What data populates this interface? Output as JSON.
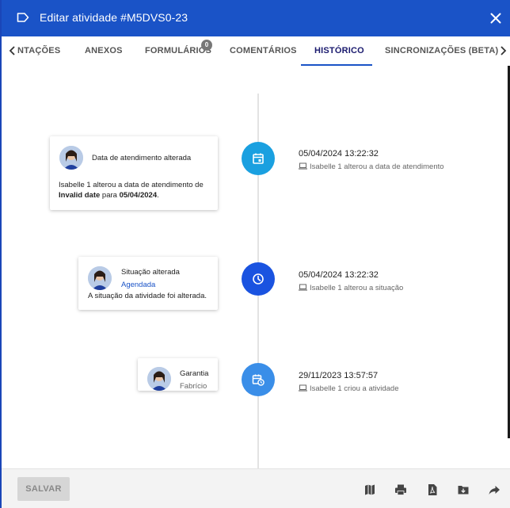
{
  "header": {
    "title": "Editar atividade  #M5DVS0-23"
  },
  "tabs": [
    {
      "label": "NTAÇÕES"
    },
    {
      "label": "ANEXOS"
    },
    {
      "label": "FORMULÁRIOS",
      "badge": "0"
    },
    {
      "label": "COMENTÁRIOS"
    },
    {
      "label": "HISTÓRICO",
      "active": true
    },
    {
      "label": "SINCRONIZAÇÕES (BETA)"
    }
  ],
  "events": [
    {
      "card_title": "Data de atendimento alterada",
      "card_text_prefix": "Isabelle 1 alterou a data de atendimento de",
      "card_text_bold1": "Invalid date",
      "card_text_mid": "para",
      "card_text_bold2": "05/04/2024",
      "card_text_end": ".",
      "date": "05/04/2024 13:22:32",
      "description": "Isabelle 1 alterou a data de atendimento",
      "marker_color": "#1aa0e0"
    },
    {
      "card_title": "Situação alterada",
      "card_sub": "Agendada",
      "card_text": "A situação da atividade foi alterada.",
      "date": "05/04/2024 13:22:32",
      "description": "Isabelle 1 alterou a situação",
      "marker_color": "#1a53e0"
    },
    {
      "card_title": "Garantia",
      "card_sub": "Fabrício",
      "date": "29/11/2023 13:57:57",
      "description": "Isabelle 1 criou a atividade",
      "marker_color": "#3a8ee8"
    }
  ],
  "footer": {
    "save_label": "SALVAR"
  },
  "icons": {
    "header": [
      "label-icon",
      "close-icon"
    ],
    "markers": [
      "calendar-icon",
      "clock-icon",
      "calendar-clock-icon"
    ],
    "footer": [
      "map-icon",
      "print-icon",
      "pdf-icon",
      "download-icon",
      "share-icon"
    ]
  }
}
